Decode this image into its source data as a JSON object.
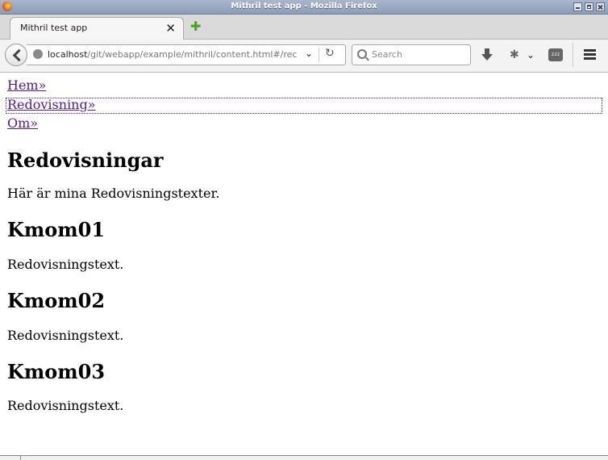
{
  "window": {
    "title": "Mithril test app - Mozilla Firefox"
  },
  "tabs": [
    {
      "label": "Mithril test app"
    }
  ],
  "toolbar": {
    "url_host": "localhost",
    "url_path": "/git/webapp/example/mithril/content.html#/rec",
    "search_placeholder": "Search",
    "sleep_label": "zzz"
  },
  "page": {
    "nav": [
      {
        "label": "Hem»"
      },
      {
        "label": "Redovisning»"
      },
      {
        "label": "Om»"
      }
    ],
    "heading": "Redovisningar",
    "intro": "Här är mina Redovisningstexter.",
    "sections": [
      {
        "title": "Kmom01",
        "text": "Redovisningstext."
      },
      {
        "title": "Kmom02",
        "text": "Redovisningstext."
      },
      {
        "title": "Kmom03",
        "text": "Redovisningstext."
      }
    ]
  },
  "colors": {
    "link": "#551a8b",
    "titlebar": "#9aa8c2"
  }
}
